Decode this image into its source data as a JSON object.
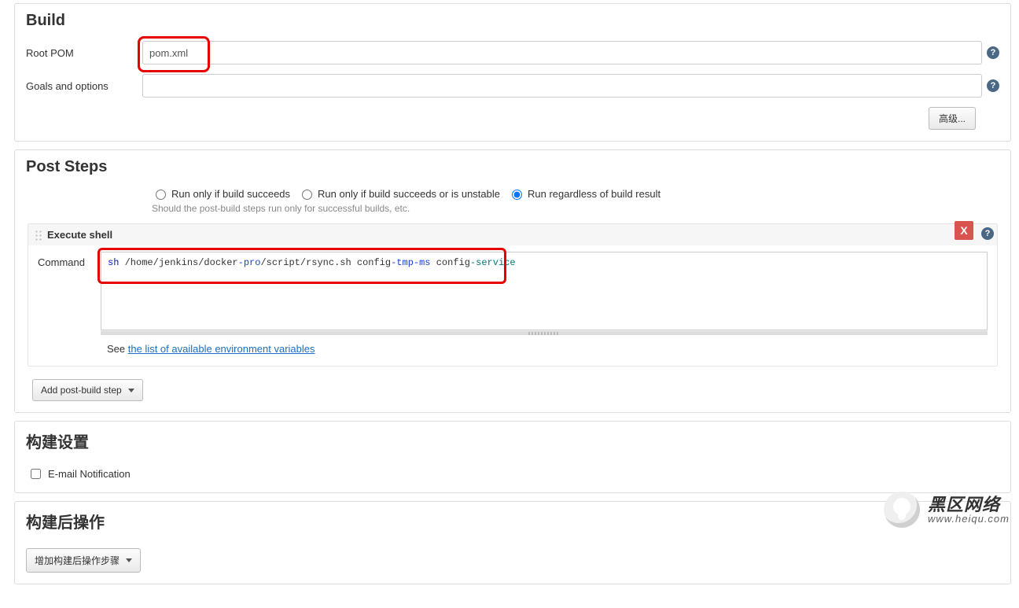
{
  "build": {
    "title": "Build",
    "root_pom_label": "Root POM",
    "root_pom_value": "pom.xml",
    "goals_label": "Goals and options",
    "goals_value": "",
    "advanced_btn": "高级..."
  },
  "post_steps": {
    "title": "Post Steps",
    "radios": {
      "r1": "Run only if build succeeds",
      "r2": "Run only if build succeeds or is unstable",
      "r3": "Run regardless of build result"
    },
    "hint": "Should the post-build steps run only for successful builds, etc.",
    "exec_shell_title": "Execute shell",
    "command_label": "Command",
    "command_tokens": [
      {
        "t": "sh",
        "c": "kw-cmd"
      },
      {
        "t": " /home/jenkins/docker",
        "c": "kw-text"
      },
      {
        "t": "-pro",
        "c": "kw-blue"
      },
      {
        "t": "/script/rsync.sh config",
        "c": "kw-text"
      },
      {
        "t": "-tmp-ms",
        "c": "kw-blue"
      },
      {
        "t": " config",
        "c": "kw-text"
      },
      {
        "t": "-service",
        "c": "kw-teal"
      }
    ],
    "see_prefix": "See ",
    "see_link": "the list of available environment variables",
    "close_x": "X",
    "add_step_btn": "Add post-build step"
  },
  "build_settings": {
    "title": "构建设置",
    "email_label": "E-mail Notification",
    "email_checked": false
  },
  "post_build_actions": {
    "title": "构建后操作",
    "add_btn": "增加构建后操作步骤"
  },
  "watermark": {
    "line1": "黑区网络",
    "line2": "www.heiqu.com"
  }
}
